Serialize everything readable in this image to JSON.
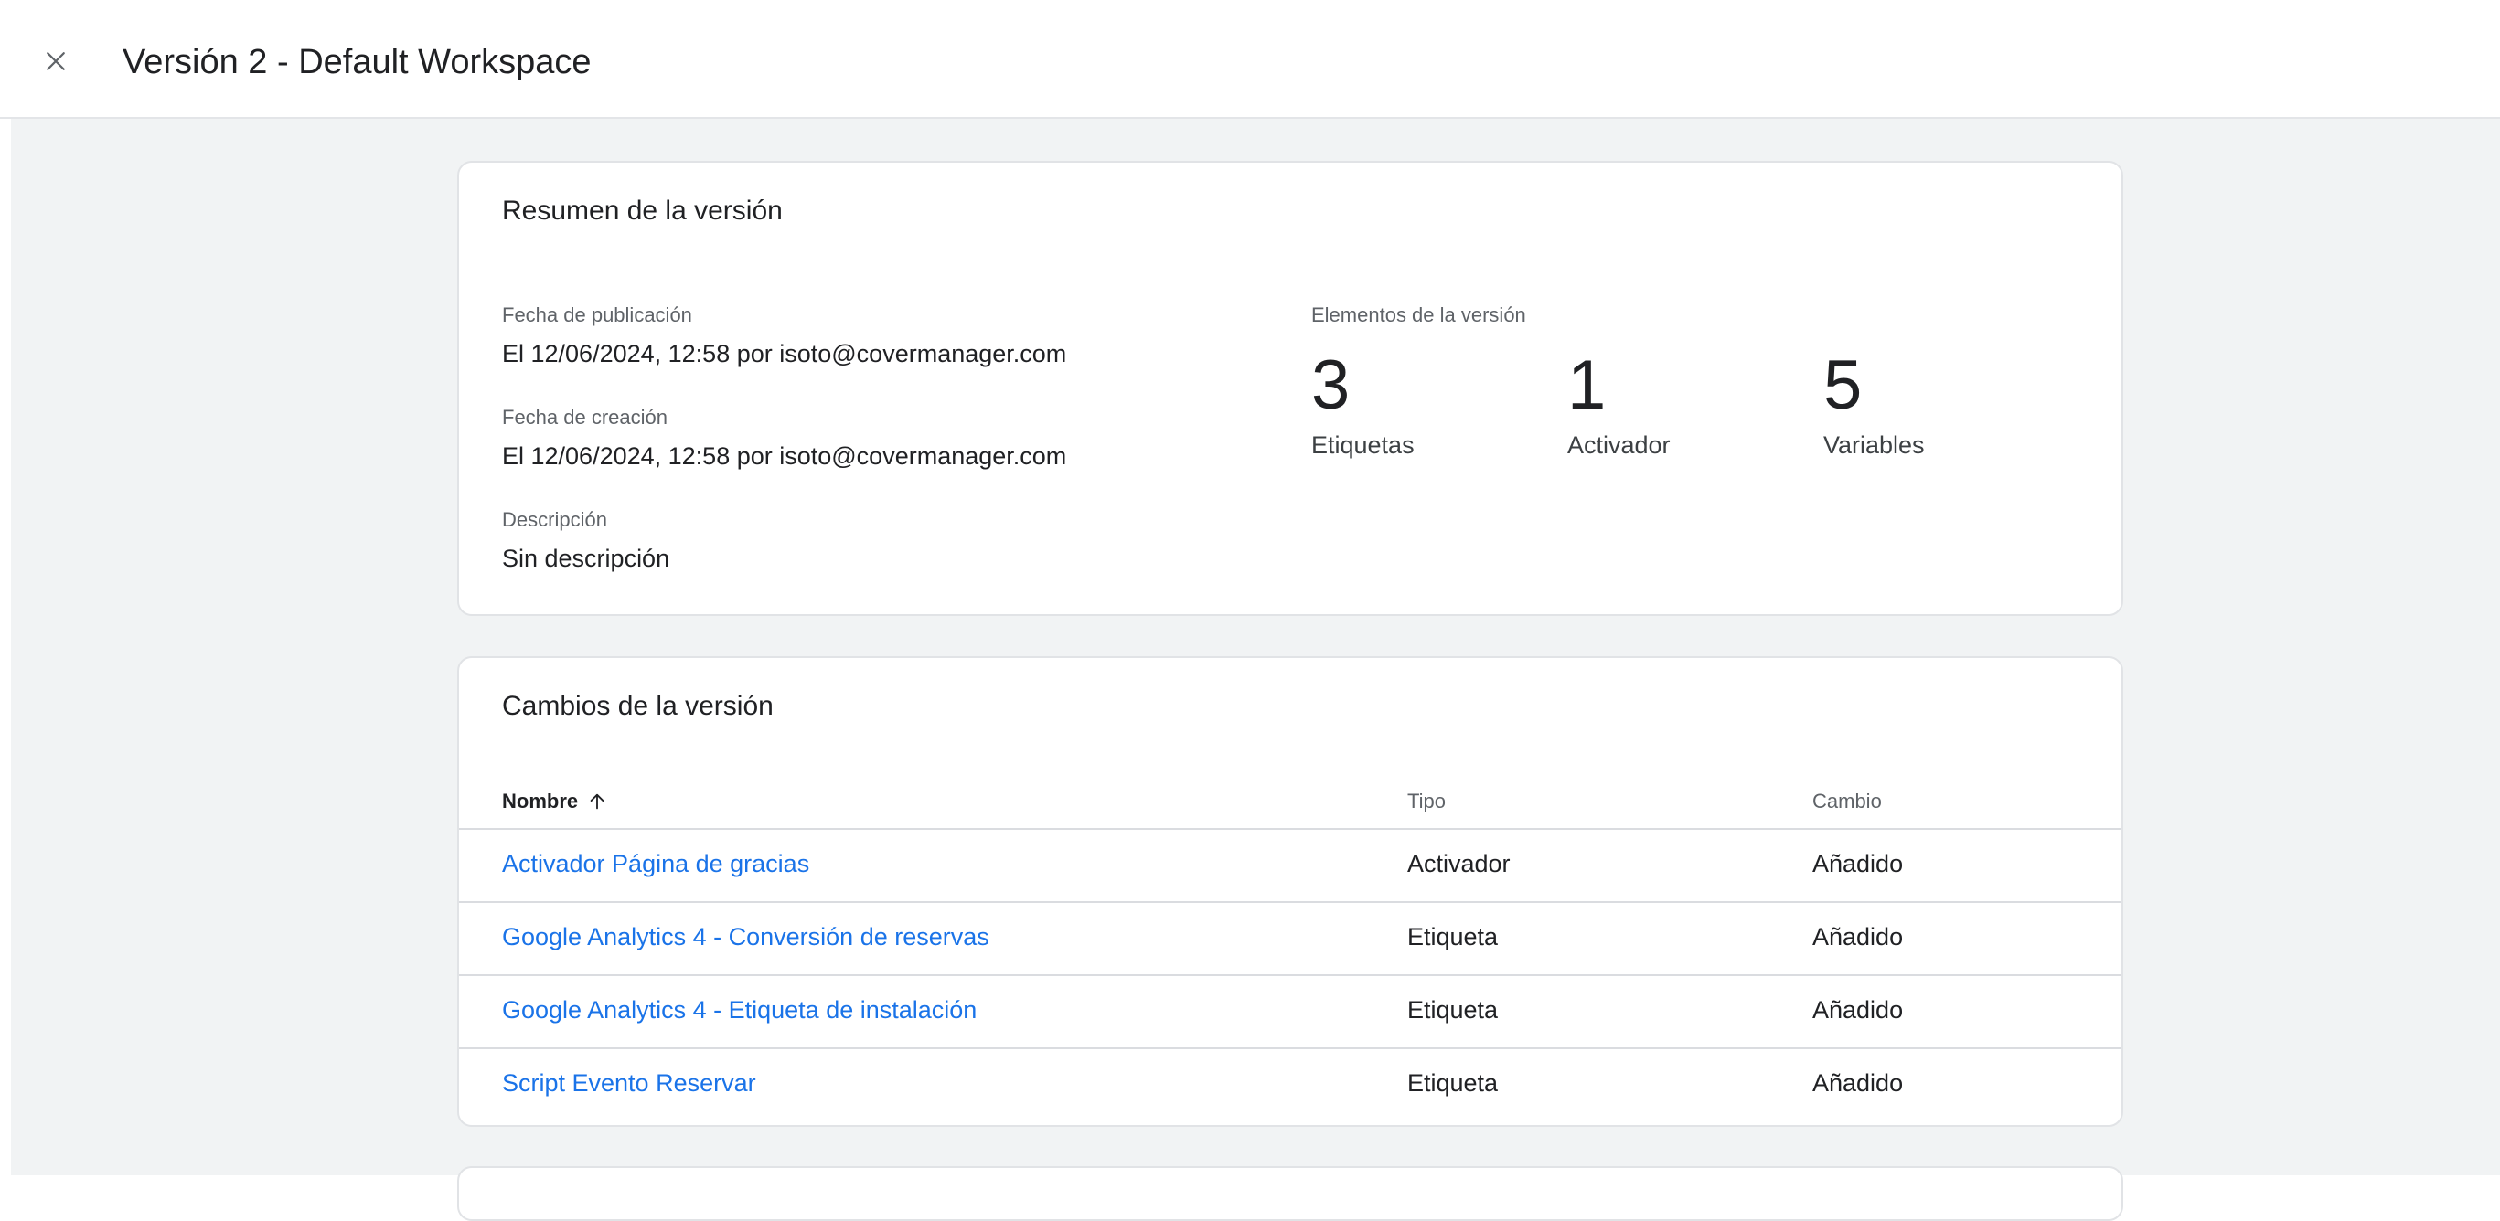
{
  "header": {
    "title": "Versión 2 - Default Workspace"
  },
  "summary": {
    "title": "Resumen de la versión",
    "published_label": "Fecha de publicación",
    "published_value": "El 12/06/2024, 12:58 por isoto@covermanager.com",
    "created_label": "Fecha de creación",
    "created_value": "El 12/06/2024, 12:58 por isoto@covermanager.com",
    "description_label": "Descripción",
    "description_value": "Sin descripción",
    "elements_label": "Elementos de la versión",
    "stats": [
      {
        "number": "3",
        "label": "Etiquetas"
      },
      {
        "number": "1",
        "label": "Activador"
      },
      {
        "number": "5",
        "label": "Variables"
      }
    ]
  },
  "changes": {
    "title": "Cambios de la versión",
    "columns": {
      "name": "Nombre",
      "type": "Tipo",
      "change": "Cambio"
    },
    "sort_icon": "arrow-up-icon",
    "rows": [
      {
        "name": "Activador Página de gracias",
        "type": "Activador",
        "change": "Añadido"
      },
      {
        "name": "Google Analytics 4 - Conversión de reservas",
        "type": "Etiqueta",
        "change": "Añadido"
      },
      {
        "name": "Google Analytics 4 - Etiqueta de instalación",
        "type": "Etiqueta",
        "change": "Añadido"
      },
      {
        "name": "Script Evento Reservar",
        "type": "Etiqueta",
        "change": "Añadido"
      }
    ]
  },
  "colors": {
    "link": "#1a73e8",
    "background": "#f1f3f4",
    "card": "#ffffff"
  }
}
